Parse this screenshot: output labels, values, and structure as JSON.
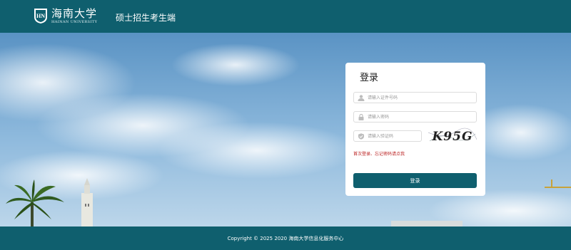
{
  "header": {
    "logo_text_cn": "海南大学",
    "logo_text_en": "HAINAN UNIVERSITY",
    "portal_title": "硕士招生考生端"
  },
  "login": {
    "title": "登录",
    "id_number_placeholder": "请输入证件号码",
    "password_placeholder": "请输入密码",
    "captcha_placeholder": "请输入验证码",
    "captcha_text": "K95G",
    "forgot_password_text": "首次登录、忘记密码请点我",
    "submit_label": "登录"
  },
  "footer": {
    "copyright": "Copyright © 2025 2020 海南大学信息化服务中心"
  },
  "colors": {
    "primary": "#0f5f6e",
    "link_red": "#bb2222",
    "card": "#ffffff"
  },
  "icons": {
    "id_field": "user-icon",
    "password_field": "lock-icon",
    "captcha_field": "shield-check-icon"
  }
}
